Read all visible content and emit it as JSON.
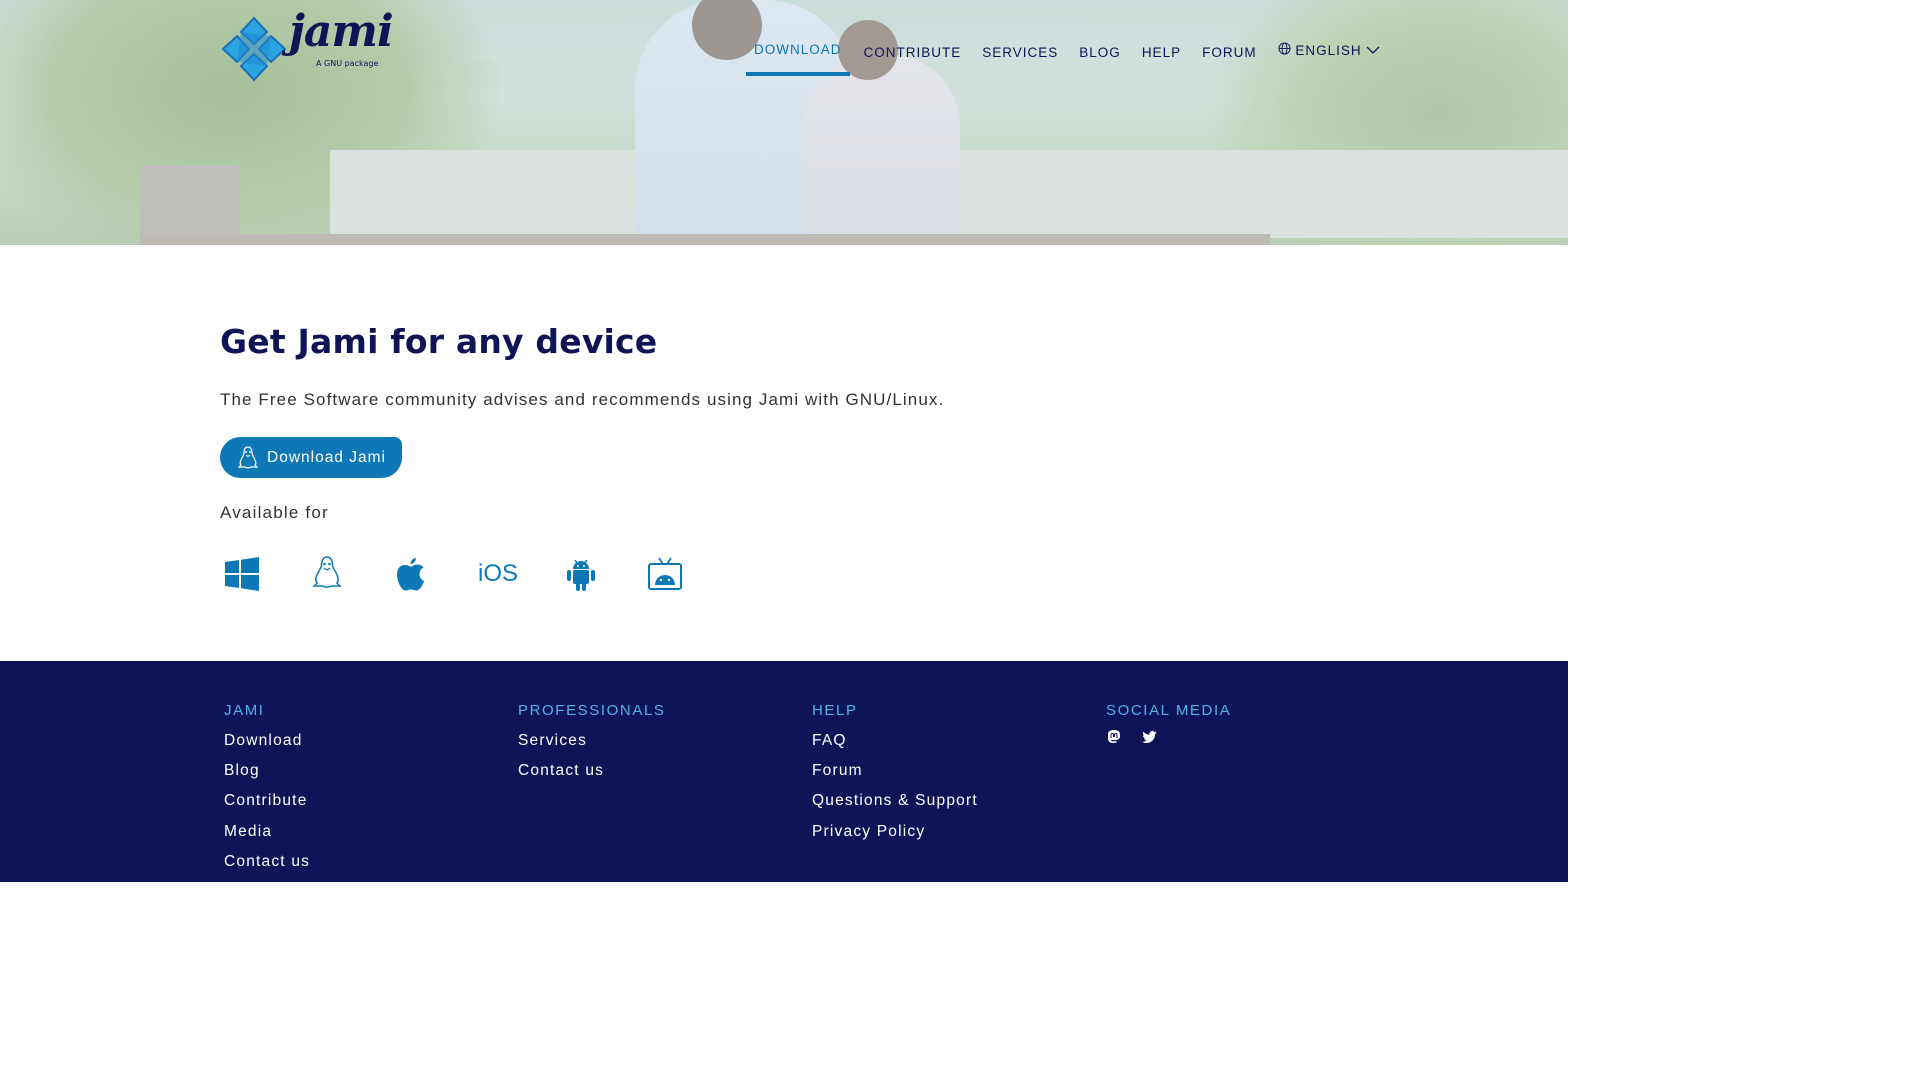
{
  "brand": {
    "name": "jami",
    "tagline": "A GNU package"
  },
  "nav": {
    "items": [
      {
        "label": "DOWNLOAD",
        "active": true
      },
      {
        "label": "CONTRIBUTE"
      },
      {
        "label": "SERVICES"
      },
      {
        "label": "BLOG"
      },
      {
        "label": "HELP"
      },
      {
        "label": "FORUM"
      }
    ],
    "language": "ENGLISH"
  },
  "main": {
    "title": "Get Jami for any device",
    "lead": "The Free Software community advises and recommends using Jami with GNU/Linux.",
    "download_button": "Download Jami",
    "available_for": "Available for",
    "platforms": [
      "windows-icon",
      "linux-icon",
      "apple-icon",
      "iOS",
      "android-icon",
      "android-tv-icon"
    ],
    "ios_label": "iOS"
  },
  "footer": {
    "columns": [
      {
        "heading": "JAMI",
        "links": [
          "Download",
          "Blog",
          "Contribute",
          "Media",
          "Contact us"
        ]
      },
      {
        "heading": "PROFESSIONALS",
        "links": [
          "Services",
          "Contact us"
        ]
      },
      {
        "heading": "HELP",
        "links": [
          "FAQ",
          "Forum",
          "Questions & Support",
          "Privacy Policy"
        ]
      },
      {
        "heading": "SOCIAL MEDIA",
        "icons": [
          "mastodon-icon",
          "twitter-icon"
        ]
      }
    ]
  },
  "colors": {
    "navy": "#0e1456",
    "accent": "#0e78b7",
    "footer_heading": "#4fb3e8"
  }
}
